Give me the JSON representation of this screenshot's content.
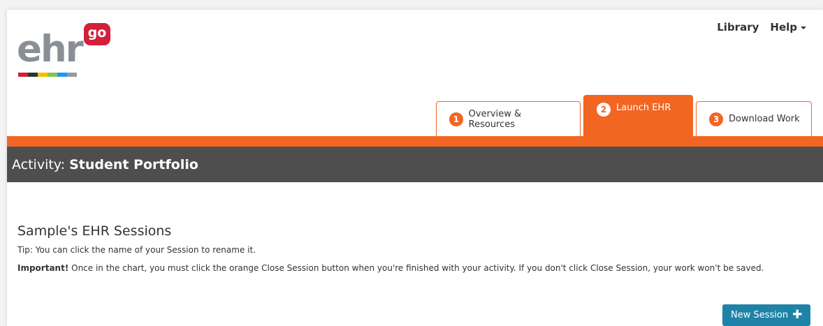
{
  "brand": {
    "logo_text": "ehr",
    "logo_badge": "go",
    "stripe_colors": [
      "#d41f3a",
      "#333333",
      "#f2c200",
      "#8bc34a",
      "#2196f3",
      "#999999"
    ]
  },
  "topnav": {
    "library": "Library",
    "help": "Help"
  },
  "tabs": [
    {
      "number": "1",
      "label": "Overview & Resources",
      "active": false
    },
    {
      "number": "2",
      "label": "Launch EHR",
      "active": true
    },
    {
      "number": "3",
      "label": "Download Work",
      "active": false
    }
  ],
  "activity": {
    "prefix": "Activity:",
    "name": "Student Portfolio"
  },
  "sessions": {
    "title": "Sample's EHR Sessions",
    "tip": "Tip: You can click the name of your Session to rename it.",
    "important_label": "Important!",
    "important_text": " Once in the chart, you must click the orange Close Session button when you're finished with your activity. If you don't click Close Session, your work won't be saved.",
    "new_session_label": "New Session"
  },
  "colors": {
    "accent": "#f26522",
    "dark_bar": "#4e4e4e",
    "button": "#1f83a8",
    "logo_red": "#d41f3a"
  }
}
